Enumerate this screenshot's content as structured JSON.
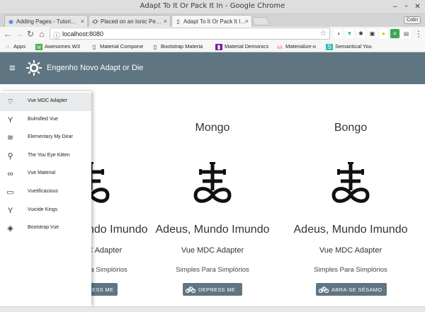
{
  "window": {
    "title": "Adapt To It Or Pack It In - Google Chrome",
    "profile": "Colin"
  },
  "tabs": [
    {
      "label": "Adding Pages - Tutori…",
      "icon": "globe-icon",
      "active": false
    },
    {
      "label": "Placed on an Ionic Pe…",
      "icon": "ionic-icon",
      "active": false
    },
    {
      "label": "Adapt To It Or Pack It I…",
      "icon": "page-icon",
      "active": true
    }
  ],
  "toolbar": {
    "url": "localhost:8080"
  },
  "bookmarks": [
    {
      "label": "Apps",
      "icon": "apps-icon"
    },
    {
      "label": "Awesomes W3",
      "icon": "w3-icon"
    },
    {
      "label": "Material Compone",
      "icon": "page-icon"
    },
    {
      "label": "Bootstrap Materia",
      "icon": "page-icon"
    },
    {
      "label": "Material Demonics",
      "icon": "material-icon"
    },
    {
      "label": "Materialize-o",
      "icon": "materialize-icon"
    },
    {
      "label": "Semantical You",
      "icon": "semantic-icon"
    }
  ],
  "appbar": {
    "title": "Engenho Novo Adapt or Die"
  },
  "drawer": {
    "items": [
      {
        "label": "Vue MDC Adapter",
        "icon": "satellite-icon",
        "active": true
      },
      {
        "label": "Bulmified Vue",
        "icon": "cocktail-icon",
        "active": false
      },
      {
        "label": "Elementary My Dear",
        "icon": "waves-icon",
        "active": false
      },
      {
        "label": "The You Eye Kitten",
        "icon": "running-icon",
        "active": false
      },
      {
        "label": "Vue Material",
        "icon": "infinity-icon",
        "active": false
      },
      {
        "label": "Vuetificacious",
        "icon": "laptop-icon",
        "active": false
      },
      {
        "label": "Vuicide Kings",
        "icon": "cocktail-icon",
        "active": false
      },
      {
        "label": "Bootstrap Vue",
        "icon": "stack-icon",
        "active": false
      }
    ]
  },
  "cards": [
    {
      "title": "",
      "heading": "Adeus, Mundo Imundo",
      "subtitle": "Vue MDC Adapter",
      "text": "Simples Para Simplórios",
      "button": "DEPRESS ME"
    },
    {
      "title": "Mongo",
      "heading": "Adeus, Mundo Imundo",
      "subtitle": "Vue MDC Adapter",
      "text": "Simples Para Simplórios",
      "button": "DEPRESS ME"
    },
    {
      "title": "Bongo",
      "heading": "Adeus, Mundo Imundo",
      "subtitle": "Vue MDC Adapter",
      "text": "Simples Para Simplórios",
      "button": "ABRA-SE SÉSAMO"
    }
  ],
  "colors": {
    "appbar": "#5f7682",
    "button": "#5f7682",
    "drawer_active": "#e8eaeb"
  }
}
